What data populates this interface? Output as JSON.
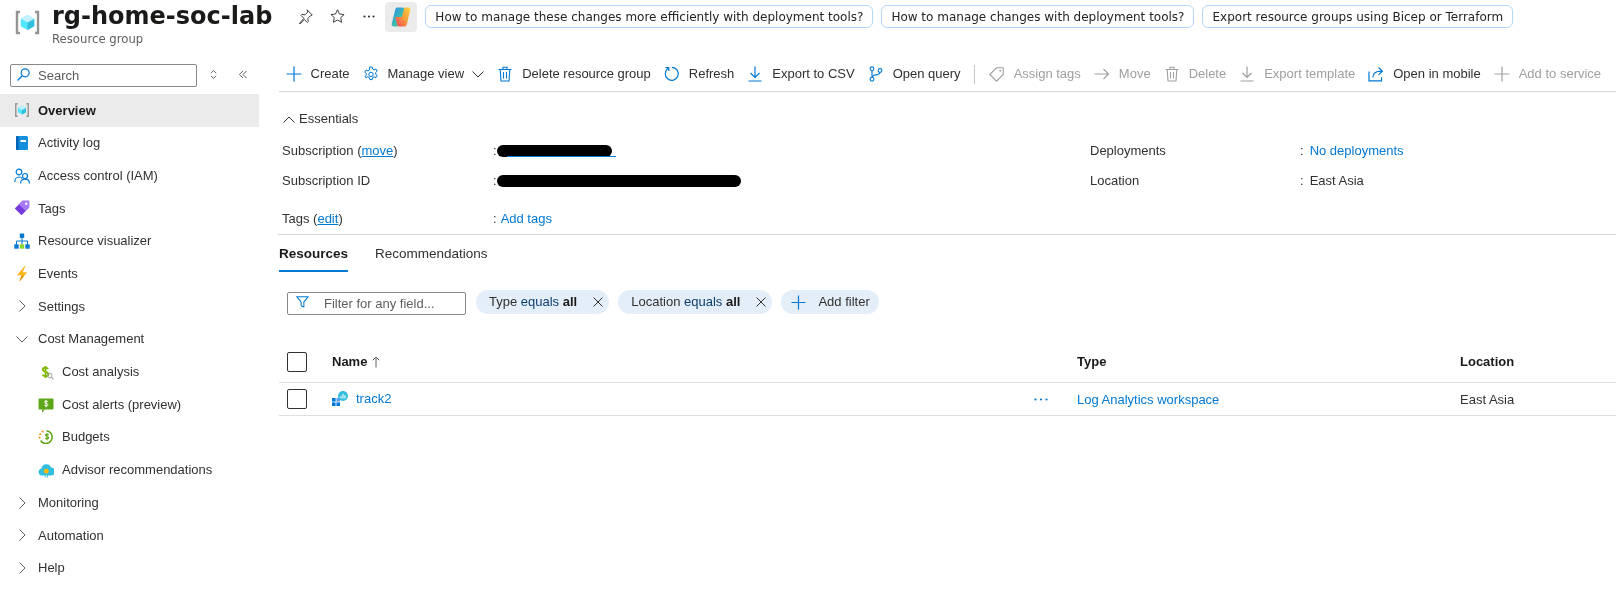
{
  "header": {
    "title": "rg-home-soc-lab",
    "subtitle": "Resource group",
    "suggestions": [
      "How to manage these changes more efficiently with deployment tools?",
      "How to manage changes with deployment tools?",
      "Export resource groups using Bicep or Terraform"
    ]
  },
  "sidebar": {
    "search": {
      "placeholder": "Search"
    },
    "items": [
      {
        "kind": "page",
        "label": "Overview",
        "selected": true
      },
      {
        "kind": "page",
        "label": "Activity log",
        "selected": false
      },
      {
        "kind": "page",
        "label": "Access control (IAM)",
        "selected": false
      },
      {
        "kind": "page",
        "label": "Tags",
        "selected": false
      },
      {
        "kind": "page",
        "label": "Resource visualizer",
        "selected": false
      },
      {
        "kind": "page",
        "label": "Events",
        "selected": false
      },
      {
        "kind": "group",
        "label": "Settings",
        "expanded": false
      },
      {
        "kind": "group",
        "label": "Cost Management",
        "expanded": true,
        "children": [
          {
            "label": "Cost analysis",
            "selected": false
          },
          {
            "label": "Cost alerts (preview)",
            "selected": false
          },
          {
            "label": "Budgets",
            "selected": false
          },
          {
            "label": "Advisor recommendations",
            "selected": false
          }
        ]
      },
      {
        "kind": "group",
        "label": "Monitoring",
        "expanded": false
      },
      {
        "kind": "group",
        "label": "Automation",
        "expanded": false
      },
      {
        "kind": "group",
        "label": "Help",
        "expanded": false
      }
    ]
  },
  "toolbar": [
    {
      "kind": "button",
      "label": "Create",
      "disabled": false,
      "menu": false
    },
    {
      "kind": "button",
      "label": "Manage view",
      "disabled": false,
      "menu": true
    },
    {
      "kind": "button",
      "label": "Delete resource group",
      "disabled": false,
      "menu": false
    },
    {
      "kind": "button",
      "label": "Refresh",
      "disabled": false,
      "menu": false
    },
    {
      "kind": "button",
      "label": "Export to CSV",
      "disabled": false,
      "menu": false
    },
    {
      "kind": "button",
      "label": "Open query",
      "disabled": false,
      "menu": false
    },
    {
      "kind": "separator"
    },
    {
      "kind": "button",
      "label": "Assign tags",
      "disabled": true,
      "menu": false
    },
    {
      "kind": "button",
      "label": "Move",
      "disabled": true,
      "menu": false
    },
    {
      "kind": "button",
      "label": "Delete",
      "disabled": true,
      "menu": false
    },
    {
      "kind": "button",
      "label": "Export template",
      "disabled": true,
      "menu": false
    },
    {
      "kind": "button",
      "label": "Open in mobile",
      "disabled": false,
      "menu": false
    },
    {
      "kind": "button",
      "label": "Add to service",
      "disabled": true,
      "menu": false
    }
  ],
  "essentials": {
    "title": "Essentials",
    "expanded": true,
    "columns": [
      [
        {
          "label": "Subscription (",
          "link": "move",
          "label_end": ")",
          "separator": ":",
          "value": {
            "redacted": true,
            "link": true
          }
        },
        {
          "label": "Subscription ID",
          "separator": ":",
          "value": {
            "redacted": true,
            "link": false
          }
        }
      ],
      [
        {
          "label": "Deployments",
          "separator": ":",
          "value": {
            "text": "No deployments",
            "redacted": false,
            "link": true
          }
        },
        {
          "label": "Location",
          "separator": ":",
          "value": {
            "text": "East Asia",
            "redacted": false,
            "link": false
          }
        }
      ]
    ],
    "tags": {
      "label": "Tags (",
      "link": "edit",
      "label_end": ")",
      "separator": ":",
      "value": {
        "text": "Add tags",
        "redacted": false,
        "link": true
      }
    }
  },
  "tabs": [
    {
      "label": "Resources",
      "selected": true
    },
    {
      "label": "Recommendations",
      "selected": false
    }
  ],
  "filters": {
    "search": {
      "placeholder": "Filter for any field..."
    },
    "pills": [
      {
        "field": "Type",
        "operator": "equals",
        "value": "all"
      },
      {
        "field": "Location",
        "operator": "equals",
        "value": "all"
      }
    ],
    "add_label": "Add filter"
  },
  "table": {
    "select_all": {
      "checked": false
    },
    "columns": [
      {
        "label": "Name",
        "sorted": true
      },
      {
        "label": "Type",
        "sorted": false
      },
      {
        "label": "Location",
        "sorted": false
      }
    ],
    "rows": [
      {
        "checked": false,
        "name": "track2",
        "type": "Log Analytics workspace",
        "location": "East Asia"
      }
    ]
  }
}
